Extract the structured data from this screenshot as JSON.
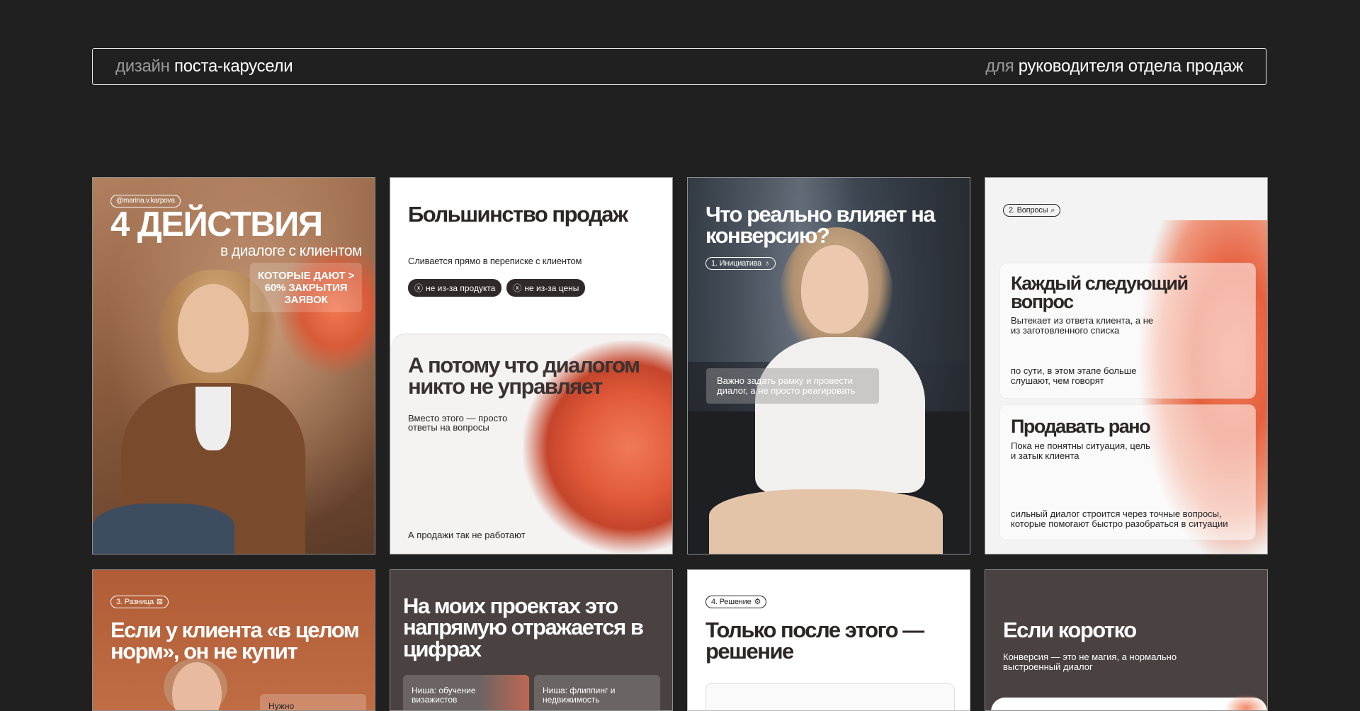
{
  "header": {
    "left_muted": "дизайн",
    "left_main": "поста-карусели",
    "right_muted": "для",
    "right_main": "руководителя отдела продаж"
  },
  "cards": [
    {
      "tag": "@marina.v.karpova",
      "title": "4 ДЕЙСТВИЯ",
      "subtitle": "в диалоге с клиентом",
      "box": "КОТОРЫЕ ДАЮТ > 60% ЗАКРЫТИЯ ЗАЯВОК"
    },
    {
      "title": "Большинство продаж",
      "text": "Сливается прямо в переписке с клиентом",
      "chips": [
        "не из-за продукта",
        "не из-за цены"
      ],
      "title2": "А потому что диалогом никто не управляет",
      "text2": "Вместо этого — просто ответы на вопросы",
      "footer": "А продажи так не работают"
    },
    {
      "title": "Что реально влияет на конверсию?",
      "tag": "1. Инициатива",
      "box": "Важно задать рамку и провести диалог, а не просто реагировать"
    },
    {
      "tag": "2. Вопросы",
      "title1": "Каждый следующий вопрос",
      "text1": "Вытекает из ответа клиента, а не из заготовленного списка",
      "note1": "по сути, в этом этапе больше слушают, чем говорят",
      "title2": "Продавать рано",
      "text2": "Пока не понятны ситуация, цель и затык клиента",
      "note2": "сильный диалог строится через точные вопросы, которые помогают быстро разобраться в ситуации"
    },
    {
      "tag": "3. Разница",
      "title": "Если у клиента «в целом норм», он не купит",
      "box": "Нужно"
    },
    {
      "title": "На моих проектах это напрямую отражается в цифрах",
      "cases": [
        "Ниша: обучение визажистов",
        "Ниша: флиппинг и недвижимость"
      ]
    },
    {
      "tag": "4. Решение",
      "title": "Только после этого — решение"
    },
    {
      "title": "Если коротко",
      "text": "Конверсия — это не магия, а нормально выстроенный диалог"
    }
  ],
  "icons": {
    "chip_icon": "close-circle-icon",
    "tag1_icon": "lightbulb-icon",
    "tag2_icon": "search-icon",
    "tag3_icon": "cross-icon",
    "tag4_icon": "settings-icon"
  },
  "colors": {
    "background": "#212021",
    "accent": "#e6603e",
    "dark_card": "#4a4241"
  }
}
